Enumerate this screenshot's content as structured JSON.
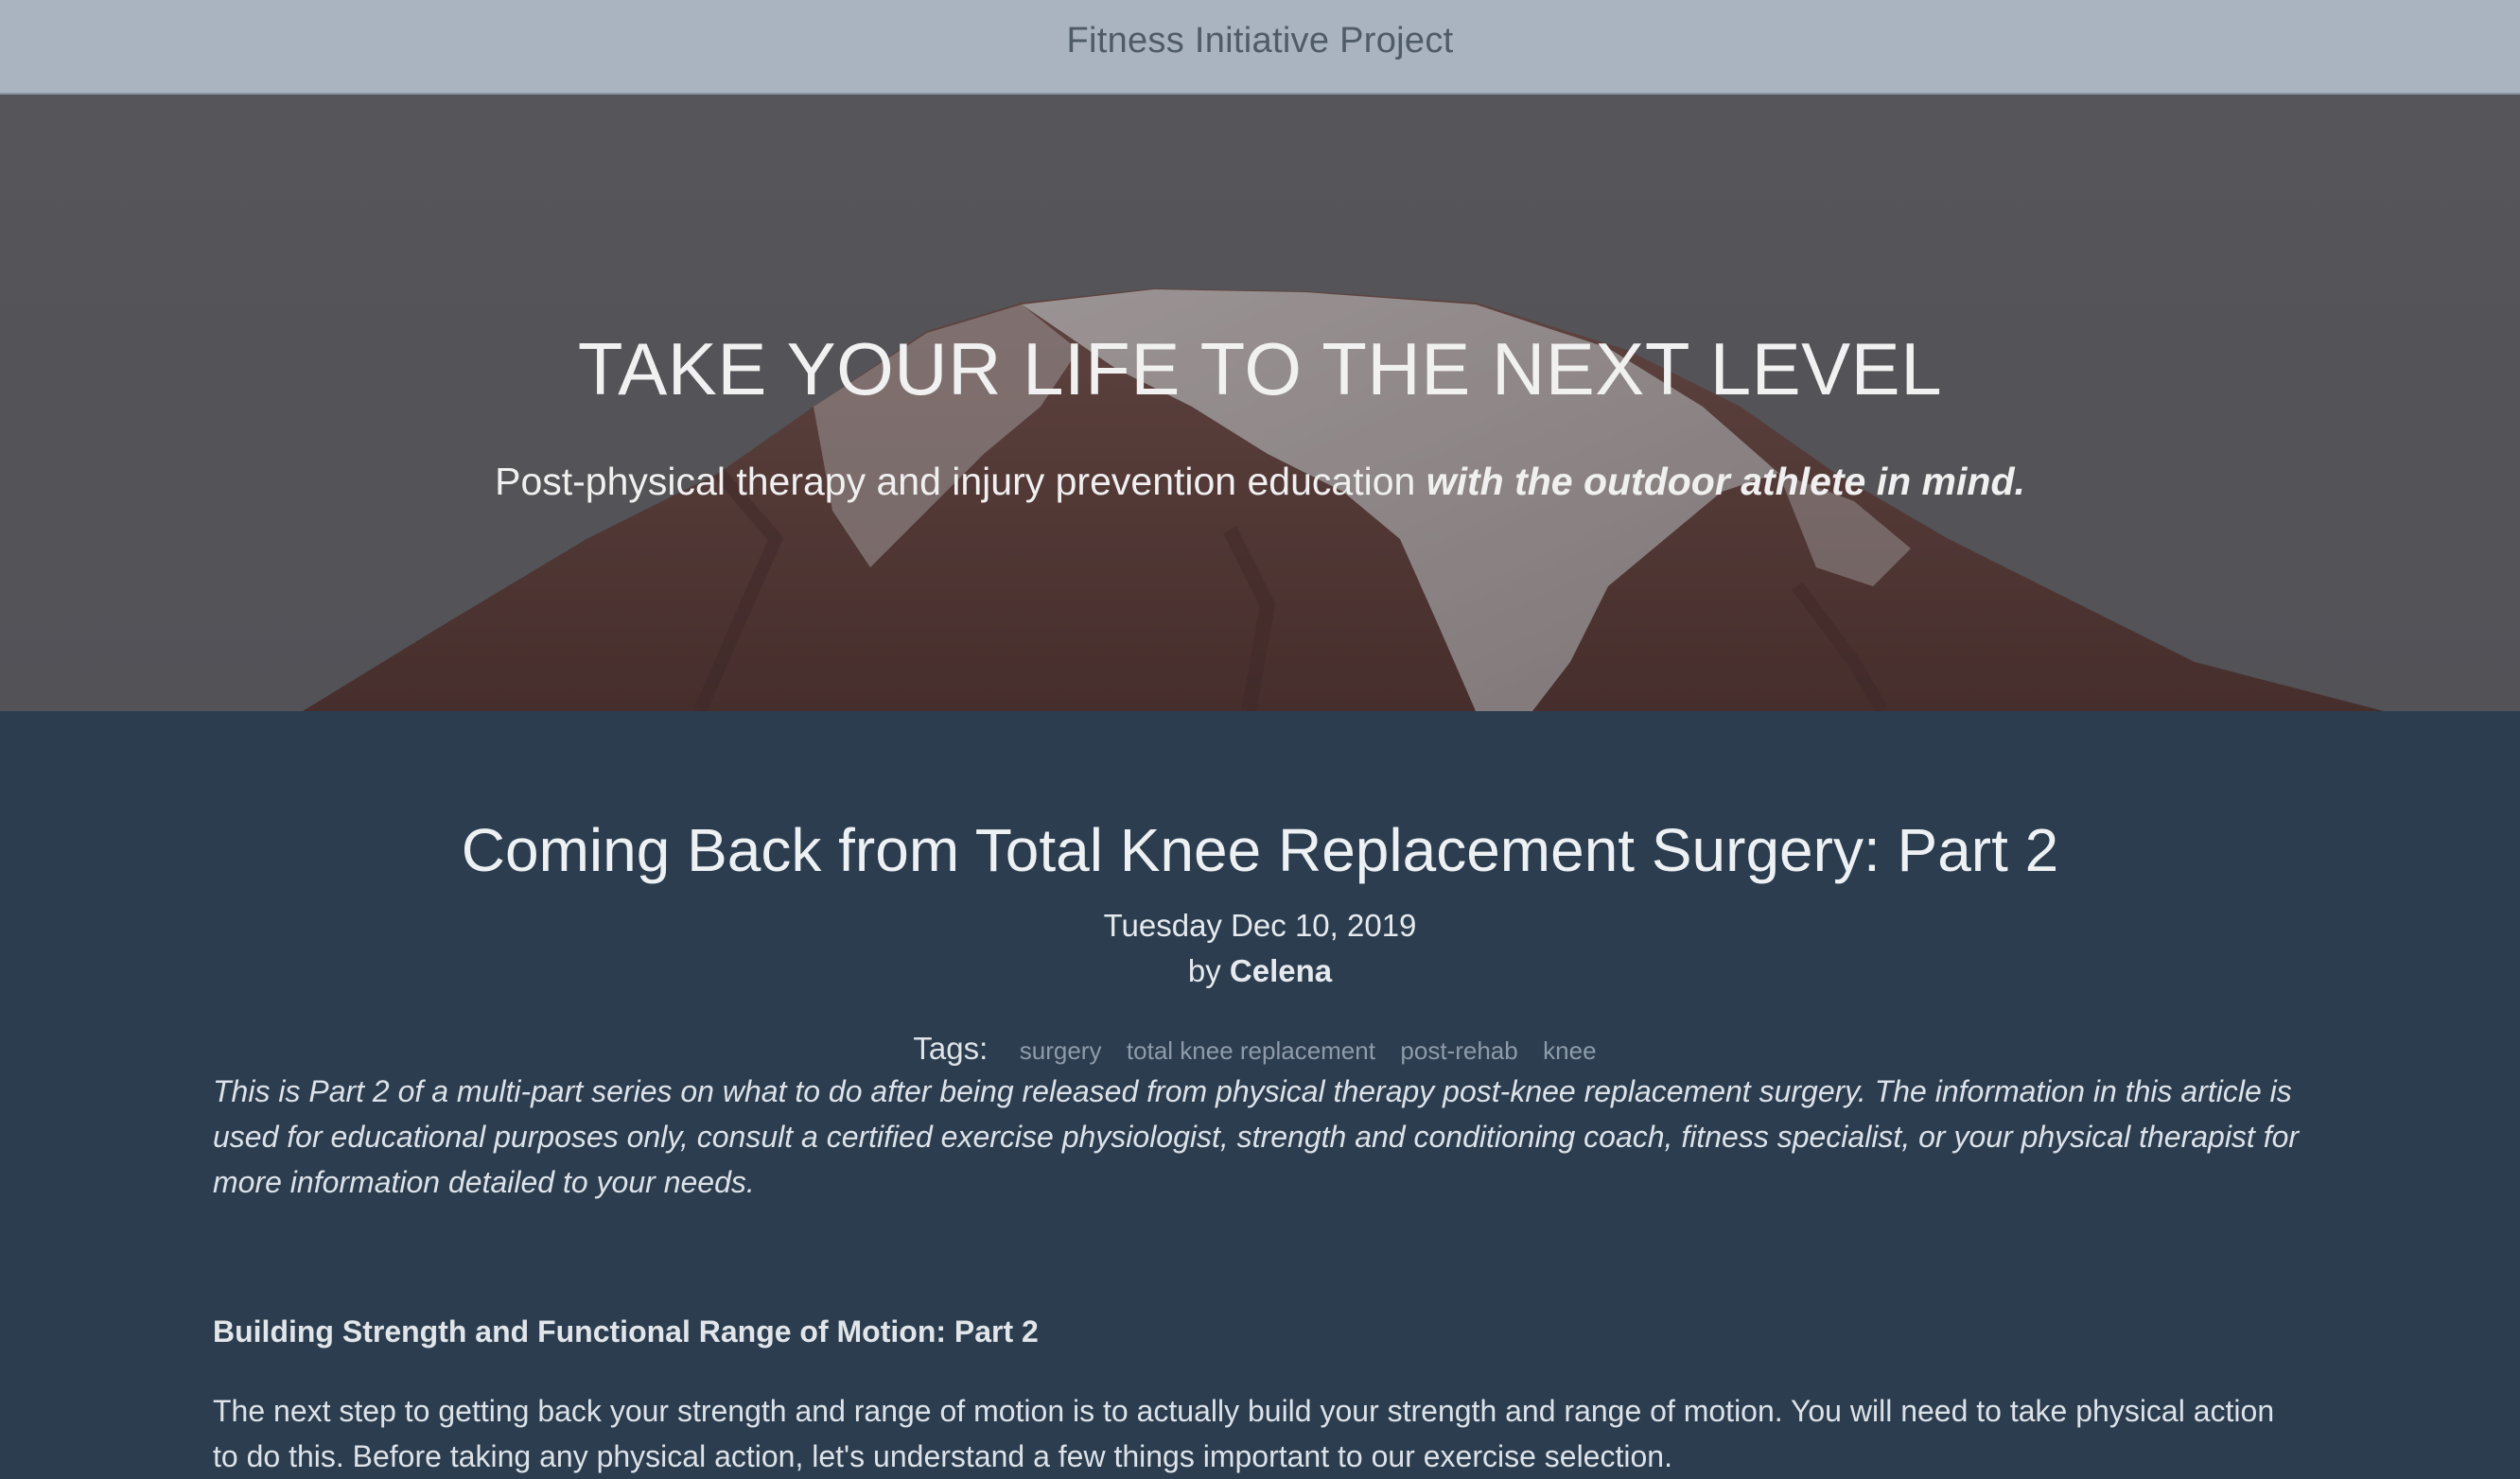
{
  "header": {
    "site_title": "Fitness Initiative Project"
  },
  "hero": {
    "heading": "TAKE YOUR LIFE TO THE NEXT LEVEL",
    "subheading_plain": "Post-physical therapy and injury prevention education ",
    "subheading_emphasis": "with the outdoor athlete in mind."
  },
  "post": {
    "title": "Coming Back from Total Knee Replacement Surgery: Part 2",
    "date": "Tuesday Dec 10, 2019",
    "byline_prefix": "by ",
    "author": "Celena",
    "tags_label": "Tags:",
    "tags": [
      "surgery",
      "total knee replacement",
      "post-rehab",
      "knee"
    ],
    "intro": "This is Part 2 of a multi-part series on what to do after being released from physical therapy post-knee replacement surgery.  The information in this article is used for educational purposes only, consult a certified exercise physiologist, strength and conditioning coach, fitness specialist, or your physical therapist for more information detailed to your needs.",
    "section_heading": "Building Strength and Functional Range of Motion: Part 2",
    "body": "The next step to getting back your strength and range of motion is to actually build your strength and range of motion.  You will need to take physical action to do this. Before taking any physical action, let's understand a few things important to our exercise selection."
  },
  "colors": {
    "topbar": "#a9b4c0",
    "article_background": "#2b3d4f",
    "hero_overlay": "#5f5f63"
  }
}
